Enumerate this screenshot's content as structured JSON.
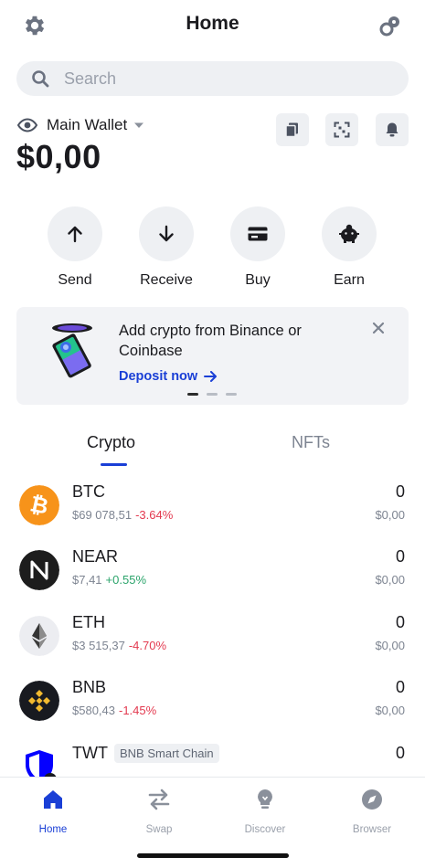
{
  "header": {
    "title": "Home"
  },
  "search": {
    "placeholder": "Search"
  },
  "wallet": {
    "name": "Main Wallet",
    "balance": "$0,00"
  },
  "actions": [
    {
      "label": "Send",
      "icon": "arrow-up-icon"
    },
    {
      "label": "Receive",
      "icon": "arrow-down-icon"
    },
    {
      "label": "Buy",
      "icon": "card-icon"
    },
    {
      "label": "Earn",
      "icon": "piggy-icon"
    }
  ],
  "banner": {
    "text": "Add crypto from Binance or Coinbase",
    "link": "Deposit now",
    "dots": 3,
    "active_dot": 0
  },
  "tabs": [
    {
      "label": "Crypto",
      "active": true
    },
    {
      "label": "NFTs",
      "active": false
    }
  ],
  "assets": [
    {
      "symbol": "BTC",
      "price": "$69 078,51",
      "change": "-3.64%",
      "direction": "down",
      "amount": "0",
      "value": "$0,00",
      "color": "#f7931a"
    },
    {
      "symbol": "NEAR",
      "price": "$7,41",
      "change": "+0.55%",
      "direction": "up",
      "amount": "0",
      "value": "$0,00",
      "color": "#1d1d1d"
    },
    {
      "symbol": "ETH",
      "price": "$3 515,37",
      "change": "-4.70%",
      "direction": "down",
      "amount": "0",
      "value": "$0,00",
      "color": "#ecedf1"
    },
    {
      "symbol": "BNB",
      "price": "$580,43",
      "change": "-1.45%",
      "direction": "down",
      "amount": "0",
      "value": "$0,00",
      "color": "#181a20"
    },
    {
      "symbol": "TWT",
      "chain": "BNB Smart Chain",
      "price": "",
      "change": "",
      "direction": "down",
      "amount": "0",
      "value": "",
      "color": "#0500ff"
    }
  ],
  "tabbar": [
    {
      "label": "Home",
      "active": true
    },
    {
      "label": "Swap",
      "active": false
    },
    {
      "label": "Discover",
      "active": false
    },
    {
      "label": "Browser",
      "active": false
    }
  ],
  "colors": {
    "accent": "#1a3fd6",
    "down": "#e3394f",
    "up": "#2ba46b",
    "muted": "#7d8491"
  }
}
